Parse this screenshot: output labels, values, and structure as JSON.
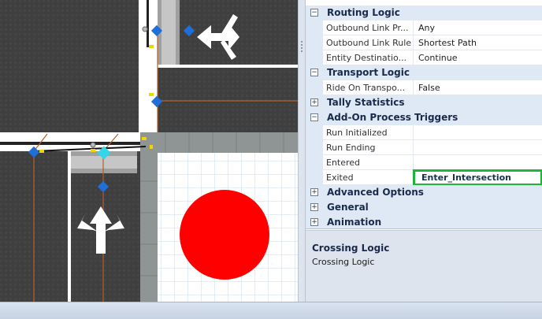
{
  "property_grid": {
    "routing_logic": {
      "label": "Routing Logic",
      "rows": [
        {
          "name": "Outbound Link Pr...",
          "value": "Any"
        },
        {
          "name": "Outbound Link Rule",
          "value": "Shortest Path"
        },
        {
          "name": "Entity Destinatio...",
          "value": "Continue"
        }
      ]
    },
    "transport_logic": {
      "label": "Transport Logic",
      "rows": [
        {
          "name": "Ride On Transpo...",
          "value": "False"
        }
      ]
    },
    "tally_statistics": {
      "label": "Tally Statistics"
    },
    "add_on_process_triggers": {
      "label": "Add-On Process Triggers",
      "rows": [
        {
          "name": "Run Initialized",
          "value": ""
        },
        {
          "name": "Run Ending",
          "value": ""
        },
        {
          "name": "Entered",
          "value": ""
        },
        {
          "name": "Exited",
          "value": "Enter_Intersection"
        }
      ]
    },
    "advanced_options": {
      "label": "Advanced Options"
    },
    "general": {
      "label": "General"
    },
    "animation": {
      "label": "Animation"
    }
  },
  "description": {
    "title": "Crossing Logic",
    "text": "Crossing Logic"
  },
  "colors": {
    "highlight_border": "#1fb53a",
    "node": "#1e6fd9",
    "selected_node": "#33d6e6",
    "traffic_light": "#ff0000",
    "path_link": "#b4602a"
  }
}
